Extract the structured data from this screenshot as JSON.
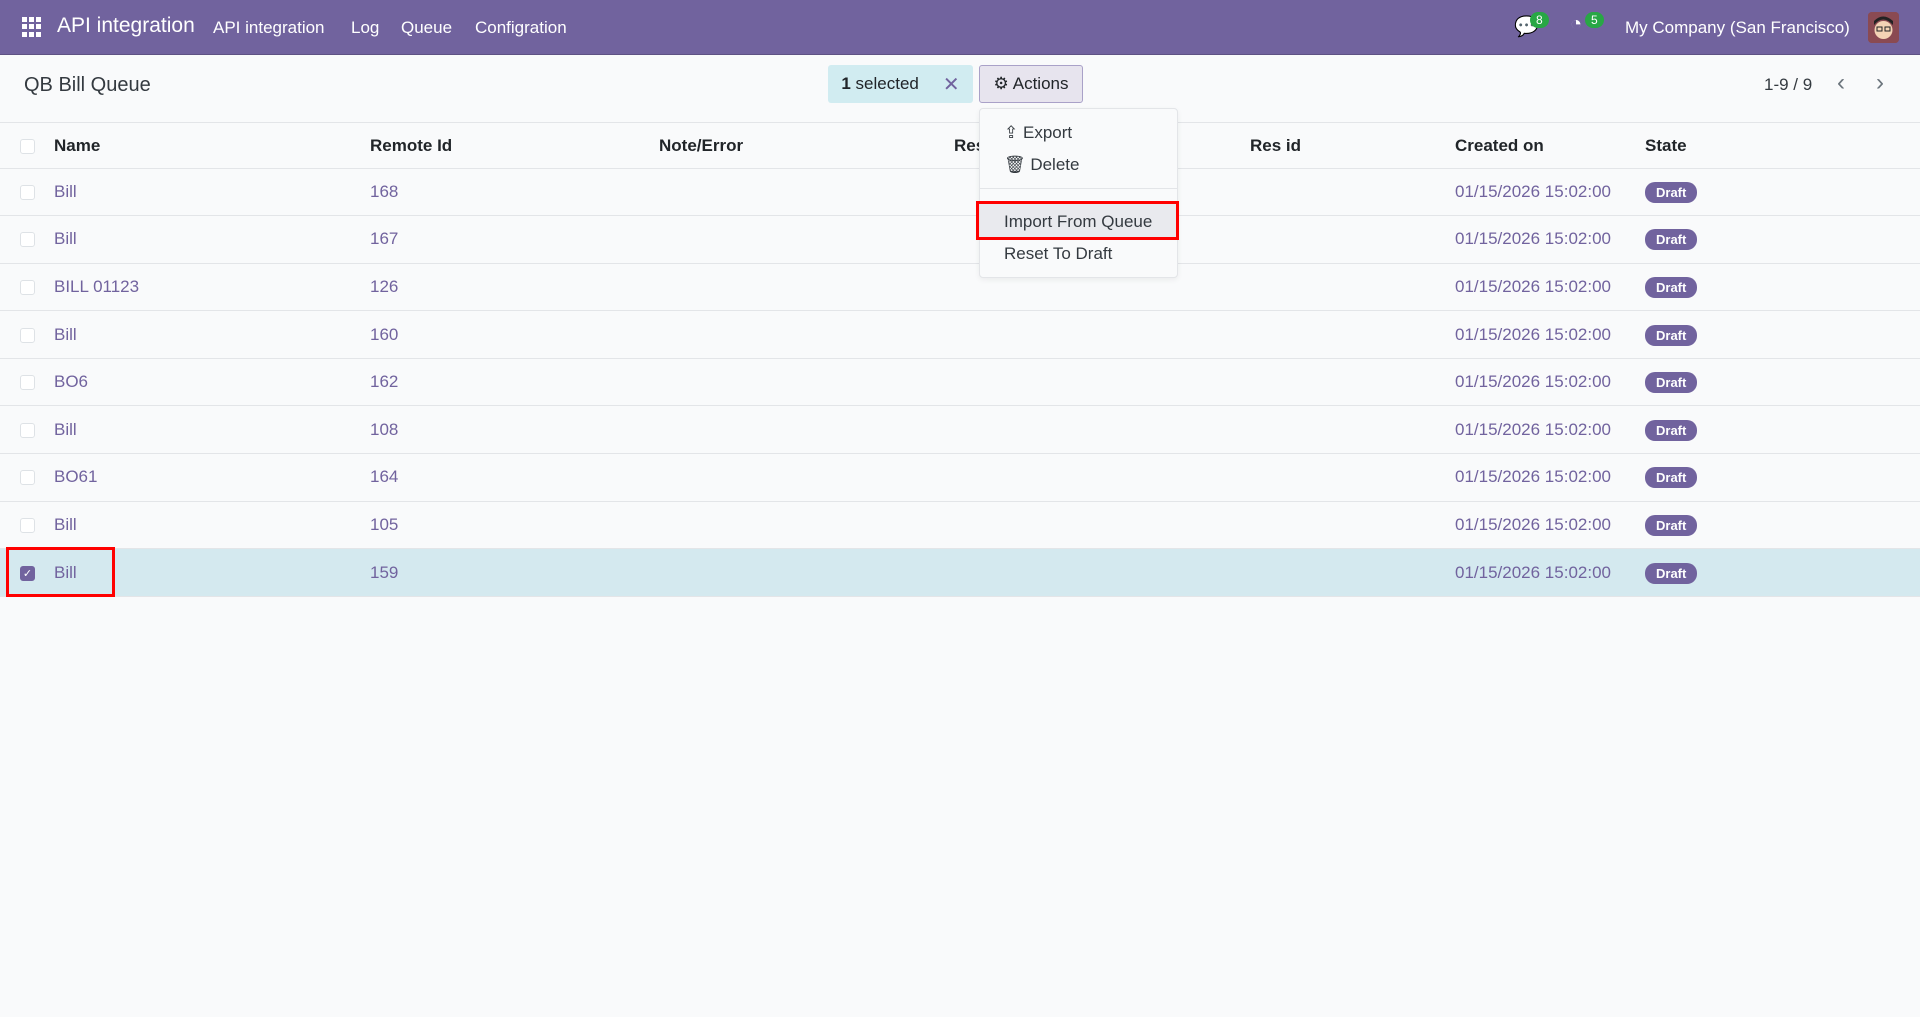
{
  "navbar": {
    "app_title": "API integration",
    "menu": [
      "API integration",
      "Log",
      "Queue",
      "Configration"
    ],
    "messages_count": "8",
    "activities_count": "5",
    "company": "My Company (San Francisco)"
  },
  "control": {
    "title": "QB Bill Queue",
    "selected_count": "1",
    "selected_label": "selected",
    "actions_label": "Actions",
    "pager": "1-9 / 9"
  },
  "actions_menu": {
    "items": [
      "Export",
      "Delete",
      "Import From Queue",
      "Reset To Draft"
    ]
  },
  "table": {
    "headers": [
      "Name",
      "Remote Id",
      "Note/Error",
      "Res",
      "Res id",
      "Created on",
      "State"
    ],
    "rows": [
      {
        "name": "Bill",
        "remote_id": "168",
        "created": "01/15/2026 15:02:00",
        "state": "Draft",
        "selected": false
      },
      {
        "name": "Bill",
        "remote_id": "167",
        "created": "01/15/2026 15:02:00",
        "state": "Draft",
        "selected": false
      },
      {
        "name": "BILL 01123",
        "remote_id": "126",
        "created": "01/15/2026 15:02:00",
        "state": "Draft",
        "selected": false
      },
      {
        "name": "Bill",
        "remote_id": "160",
        "created": "01/15/2026 15:02:00",
        "state": "Draft",
        "selected": false
      },
      {
        "name": "BO6",
        "remote_id": "162",
        "created": "01/15/2026 15:02:00",
        "state": "Draft",
        "selected": false
      },
      {
        "name": "Bill",
        "remote_id": "108",
        "created": "01/15/2026 15:02:00",
        "state": "Draft",
        "selected": false
      },
      {
        "name": "BO61",
        "remote_id": "164",
        "created": "01/15/2026 15:02:00",
        "state": "Draft",
        "selected": false
      },
      {
        "name": "Bill",
        "remote_id": "105",
        "created": "01/15/2026 15:02:00",
        "state": "Draft",
        "selected": false
      },
      {
        "name": "Bill",
        "remote_id": "159",
        "created": "01/15/2026 15:02:00",
        "state": "Draft",
        "selected": true
      }
    ]
  },
  "colors": {
    "brand": "#71639e",
    "selected_row": "#d4e9ef",
    "badge_green": "#28a745",
    "highlight": "#ff0000"
  }
}
